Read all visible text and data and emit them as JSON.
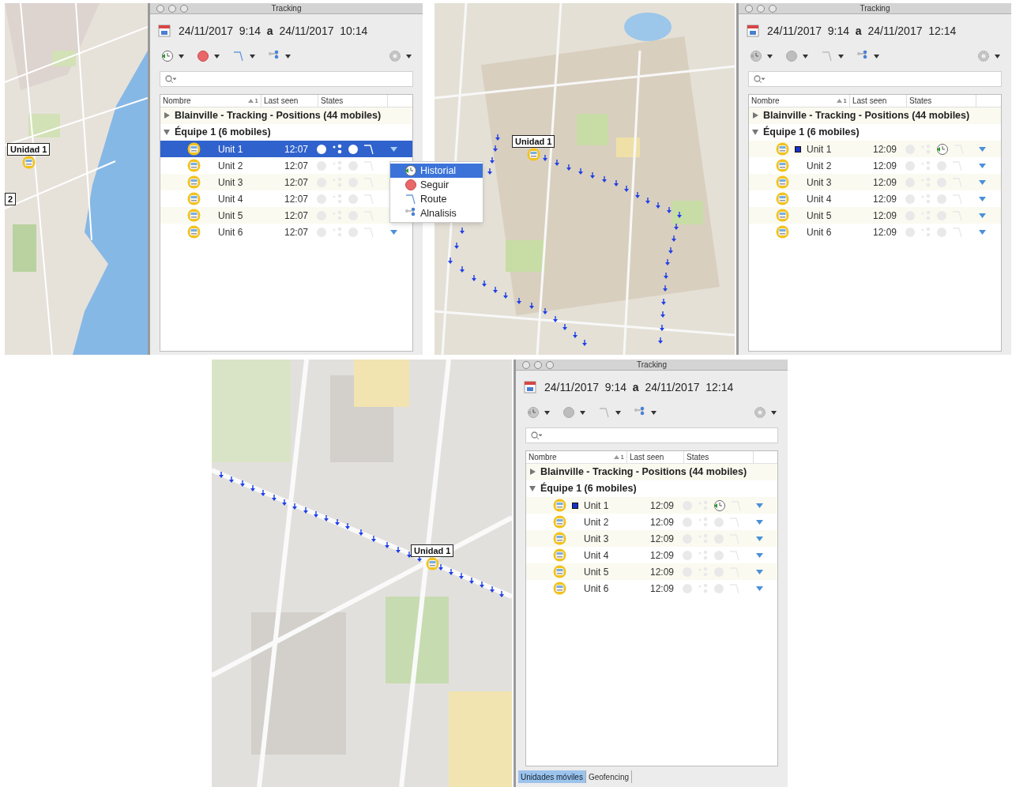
{
  "top_row": [
    {
      "kind": "map",
      "markers": [
        {
          "label": "Unidad 1"
        },
        {
          "label": "2"
        }
      ]
    },
    {
      "kind": "tracking",
      "title": "Tracking",
      "date_range": "24/11/2017  9:14  **a**  24/11/2017  10:14",
      "toolbar_enabled": true,
      "columns": [
        {
          "label": "Nombre",
          "sort_rank": "1"
        },
        {
          "label": "Last seen"
        },
        {
          "label": "States"
        }
      ],
      "tree": [
        {
          "label": "Blainville - Tracking - Positions (44 mobiles)",
          "expanded": false
        },
        {
          "label": "Équipe 1 (6 mobiles)",
          "expanded": true,
          "children": [
            {
              "name": "Unit 1",
              "time": "12:07",
              "selected": true,
              "tracked": false,
              "menu_arrow": true
            },
            {
              "name": "Unit 2",
              "time": "12:07",
              "selected": false,
              "tracked": false,
              "menu_arrow": false
            },
            {
              "name": "Unit 3",
              "time": "12:07",
              "selected": false,
              "tracked": false,
              "menu_arrow": false
            },
            {
              "name": "Unit 4",
              "time": "12:07",
              "selected": false,
              "tracked": false,
              "menu_arrow": false
            },
            {
              "name": "Unit 5",
              "time": "12:07",
              "selected": false,
              "tracked": false,
              "menu_arrow": false
            },
            {
              "name": "Unit 6",
              "time": "12:07",
              "selected": false,
              "tracked": false,
              "menu_arrow": true
            }
          ]
        }
      ],
      "context_menu": [
        {
          "label": "Historial",
          "kind": "history",
          "selected": true
        },
        {
          "label": "Seguir",
          "kind": "follow",
          "selected": false
        },
        {
          "label": "Route",
          "kind": "route",
          "selected": false
        },
        {
          "label": "Alnalisis",
          "kind": "analysis",
          "selected": false
        }
      ]
    },
    {
      "kind": "map",
      "markers": [
        {
          "label": "Unidad 1"
        }
      ]
    },
    {
      "kind": "tracking",
      "title": "Tracking",
      "date_range": "24/11/2017  9:14  **a**  24/11/2017  12:14",
      "toolbar_enabled": false,
      "columns": [
        {
          "label": "Nombre",
          "sort_rank": "1"
        },
        {
          "label": "Last seen"
        },
        {
          "label": "States"
        }
      ],
      "tree": [
        {
          "label": "Blainville - Tracking - Positions (44 mobiles)",
          "expanded": false
        },
        {
          "label": "Équipe 1 (6 mobiles)",
          "expanded": true,
          "children": [
            {
              "name": "Unit 1",
              "time": "12:09",
              "selected": false,
              "tracked": true,
              "menu_arrow": true
            },
            {
              "name": "Unit 2",
              "time": "12:09",
              "selected": false,
              "tracked": false,
              "menu_arrow": true
            },
            {
              "name": "Unit 3",
              "time": "12:09",
              "selected": false,
              "tracked": false,
              "menu_arrow": true
            },
            {
              "name": "Unit 4",
              "time": "12:09",
              "selected": false,
              "tracked": false,
              "menu_arrow": true
            },
            {
              "name": "Unit 5",
              "time": "12:09",
              "selected": false,
              "tracked": false,
              "menu_arrow": true
            },
            {
              "name": "Unit 6",
              "time": "12:09",
              "selected": false,
              "tracked": false,
              "menu_arrow": true
            }
          ]
        }
      ]
    }
  ],
  "bottom_row": [
    {
      "kind": "map",
      "markers": [
        {
          "label": "Unidad 1"
        }
      ]
    },
    {
      "kind": "tracking",
      "title": "Tracking",
      "date_range": "24/11/2017  9:14  **a**  24/11/2017  12:14",
      "toolbar_enabled": false,
      "columns": [
        {
          "label": "Nombre",
          "sort_rank": "1"
        },
        {
          "label": "Last seen"
        },
        {
          "label": "States"
        }
      ],
      "tree": [
        {
          "label": "Blainville - Tracking - Positions (44 mobiles)",
          "expanded": false
        },
        {
          "label": "Équipe 1 (6 mobiles)",
          "expanded": true,
          "children": [
            {
              "name": "Unit 1",
              "time": "12:09",
              "selected": false,
              "tracked": true,
              "menu_arrow": true
            },
            {
              "name": "Unit 2",
              "time": "12:09",
              "selected": false,
              "tracked": false,
              "menu_arrow": true
            },
            {
              "name": "Unit 3",
              "time": "12:09",
              "selected": false,
              "tracked": false,
              "menu_arrow": true
            },
            {
              "name": "Unit 4",
              "time": "12:09",
              "selected": false,
              "tracked": false,
              "menu_arrow": true
            },
            {
              "name": "Unit 5",
              "time": "12:09",
              "selected": false,
              "tracked": false,
              "menu_arrow": true
            },
            {
              "name": "Unit 6",
              "time": "12:09",
              "selected": false,
              "tracked": false,
              "menu_arrow": true
            }
          ]
        }
      ],
      "tabs": [
        {
          "label": "Unidades móviles",
          "selected": true
        },
        {
          "label": "Geofencing",
          "selected": false
        }
      ]
    }
  ]
}
